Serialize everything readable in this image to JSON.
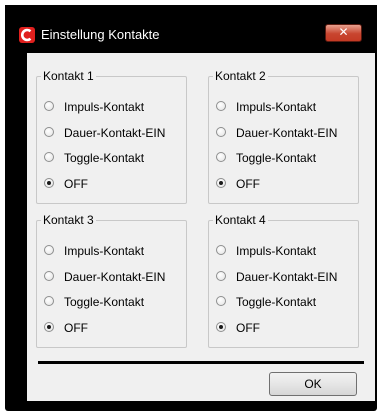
{
  "window": {
    "title": "Einstellung Kontakte",
    "close_label": "✕",
    "app_icon": "app-logo-icon",
    "close_icon": "close-icon"
  },
  "groups": [
    {
      "label": "Kontakt 1",
      "options": [
        "Impuls-Kontakt",
        "Dauer-Kontakt-EIN",
        "Toggle-Kontakt",
        "OFF"
      ],
      "selected": "OFF"
    },
    {
      "label": "Kontakt 2",
      "options": [
        "Impuls-Kontakt",
        "Dauer-Kontakt-EIN",
        "Toggle-Kontakt",
        "OFF"
      ],
      "selected": "OFF"
    },
    {
      "label": "Kontakt 3",
      "options": [
        "Impuls-Kontakt",
        "Dauer-Kontakt-EIN",
        "Toggle-Kontakt",
        "OFF"
      ],
      "selected": "OFF"
    },
    {
      "label": "Kontakt 4",
      "options": [
        "Impuls-Kontakt",
        "Dauer-Kontakt-EIN",
        "Toggle-Kontakt",
        "OFF"
      ],
      "selected": "OFF"
    }
  ],
  "footer": {
    "ok_label": "OK"
  },
  "colors": {
    "titlebar": "#000000",
    "dialog_bg": "#f0f0f0",
    "close_button": "#c8452f",
    "app_icon": "#e0201e"
  }
}
